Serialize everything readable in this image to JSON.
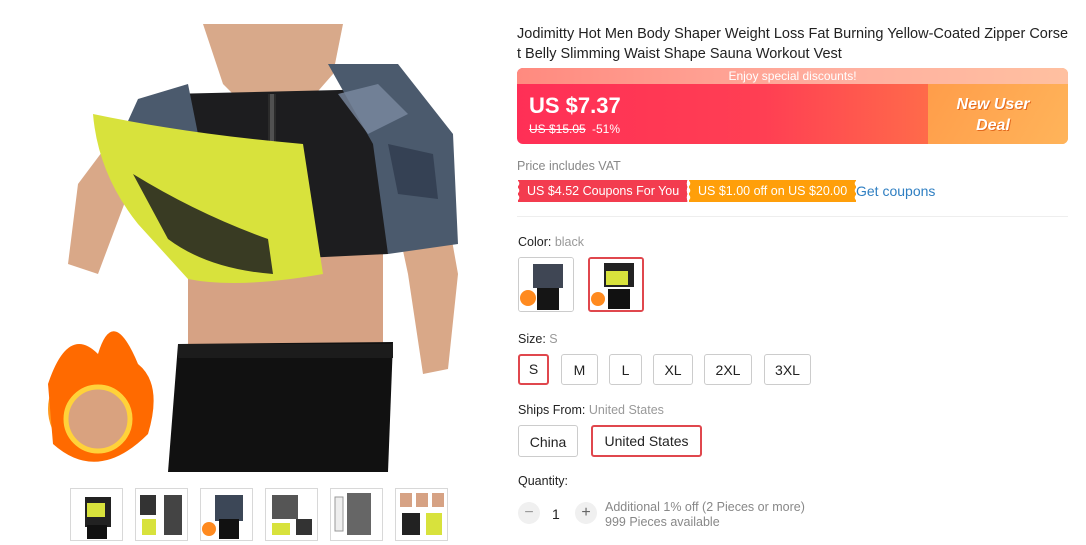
{
  "product": {
    "title": "Jodimitty Hot Men Body Shaper Weight Loss Fat Burning Yellow-Coated Zipper Corset Belly Slimming Waist Shape Sauna Workout Vest"
  },
  "banner": {
    "top_text": "Enjoy special discounts!",
    "price": "US $7.37",
    "original_price": "US $15.05",
    "discount": "-51%",
    "deal_label": "New User Deal"
  },
  "vat_note": "Price includes VAT",
  "coupons": {
    "coupon1": "US $4.52 Coupons For You",
    "coupon2": "US $1.00 off on US $20.00",
    "get_link": "Get coupons"
  },
  "color": {
    "label": "Color: ",
    "value": "black"
  },
  "size": {
    "label": "Size: ",
    "value": "S",
    "options": [
      "S",
      "M",
      "L",
      "XL",
      "2XL",
      "3XL"
    ]
  },
  "ships": {
    "label": "Ships From: ",
    "value": "United States",
    "options": [
      "China",
      "United States"
    ]
  },
  "quantity": {
    "label": "Quantity:",
    "value": "1",
    "minus": "−",
    "plus": "+",
    "note": "Additional 1% off (2 Pieces or more)",
    "available": "999 Pieces available"
  },
  "colors": {
    "accent": "#e0474d",
    "price_gradient_start": "#ff2f56",
    "deal_orange": "#ffa25a",
    "coupon_red": "#f33c4f",
    "coupon_orange": "#ff9f0a",
    "link_blue": "#2f7fc2",
    "vest_yellow": "#d8e23c"
  }
}
